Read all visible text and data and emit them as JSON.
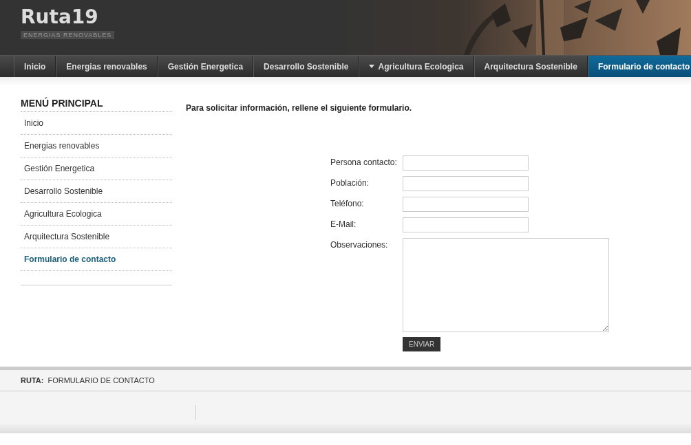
{
  "header": {
    "title": "Ruta19",
    "tagline": "ENERGIAS RENOVABLES",
    "kind": "picture"
  },
  "nav": [
    {
      "label": "Inicio",
      "selected": false,
      "has_submenu": false
    },
    {
      "label": "Energias renovables",
      "selected": false,
      "has_submenu": false
    },
    {
      "label": "Gestión Energetica",
      "selected": false,
      "has_submenu": false
    },
    {
      "label": "Desarrollo Sostenible",
      "selected": false,
      "has_submenu": false
    },
    {
      "label": "Agricultura Ecologica",
      "selected": false,
      "has_submenu": true
    },
    {
      "label": "Arquitectura Sostenible",
      "selected": false,
      "has_submenu": false
    },
    {
      "label": "Formulario de contacto",
      "selected": true,
      "has_submenu": false
    }
  ],
  "sidebar": {
    "title": "MENÚ PRINCIPAL",
    "items": [
      {
        "label": "Inicio",
        "selected": false
      },
      {
        "label": "Energias renovables",
        "selected": false
      },
      {
        "label": "Gestión Energetica",
        "selected": false
      },
      {
        "label": "Desarrollo Sostenible",
        "selected": false
      },
      {
        "label": "Agricultura Ecologica",
        "selected": false
      },
      {
        "label": "Arquitectura Sostenible",
        "selected": false
      },
      {
        "label": "Formulario de contacto",
        "selected": true
      }
    ]
  },
  "form": {
    "intro": "Para solicitar información, rellene el siguiente formulario.",
    "fields": [
      {
        "label": "Persona contacto:",
        "kind": "input"
      },
      {
        "label": "Población:",
        "kind": "input"
      },
      {
        "label": "Teléfono:",
        "kind": "input"
      },
      {
        "label": "E-Mail:",
        "kind": "input"
      },
      {
        "label": "Observaciones:",
        "kind": "textarea"
      }
    ],
    "submit": "ENVIAR"
  },
  "breadcrumb": {
    "label": "RUTA:",
    "path": "FORMULARIO DE CONTACTO"
  }
}
